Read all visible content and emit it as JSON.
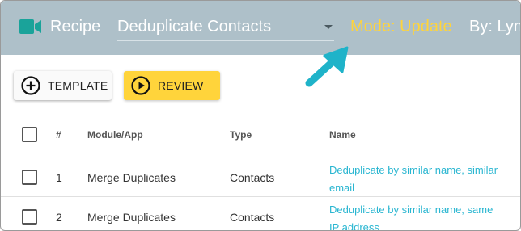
{
  "header": {
    "title": "Recipe",
    "recipe_value": "Deduplicate Contacts",
    "mode": "Mode: Update",
    "by": "By: Lynn",
    "colors": {
      "bar": "#aec0c9",
      "mode": "#ffd43b",
      "icon": "#1aa39a"
    }
  },
  "toolbar": {
    "template_label": "TEMPLATE",
    "review_label": "REVIEW"
  },
  "table": {
    "headers": {
      "num": "#",
      "module": "Module/App",
      "type": "Type",
      "name": "Name"
    },
    "rows": [
      {
        "num": "1",
        "module": "Merge Duplicates",
        "type": "Contacts",
        "name_line1": "Deduplicate by similar name, similar",
        "name_line2": "email"
      },
      {
        "num": "2",
        "module": "Merge Duplicates",
        "type": "Contacts",
        "name_line1": "Deduplicate by similar name, same",
        "name_line2": "IP address"
      }
    ]
  },
  "annotation": {
    "arrow_color": "#1fb3c9"
  }
}
